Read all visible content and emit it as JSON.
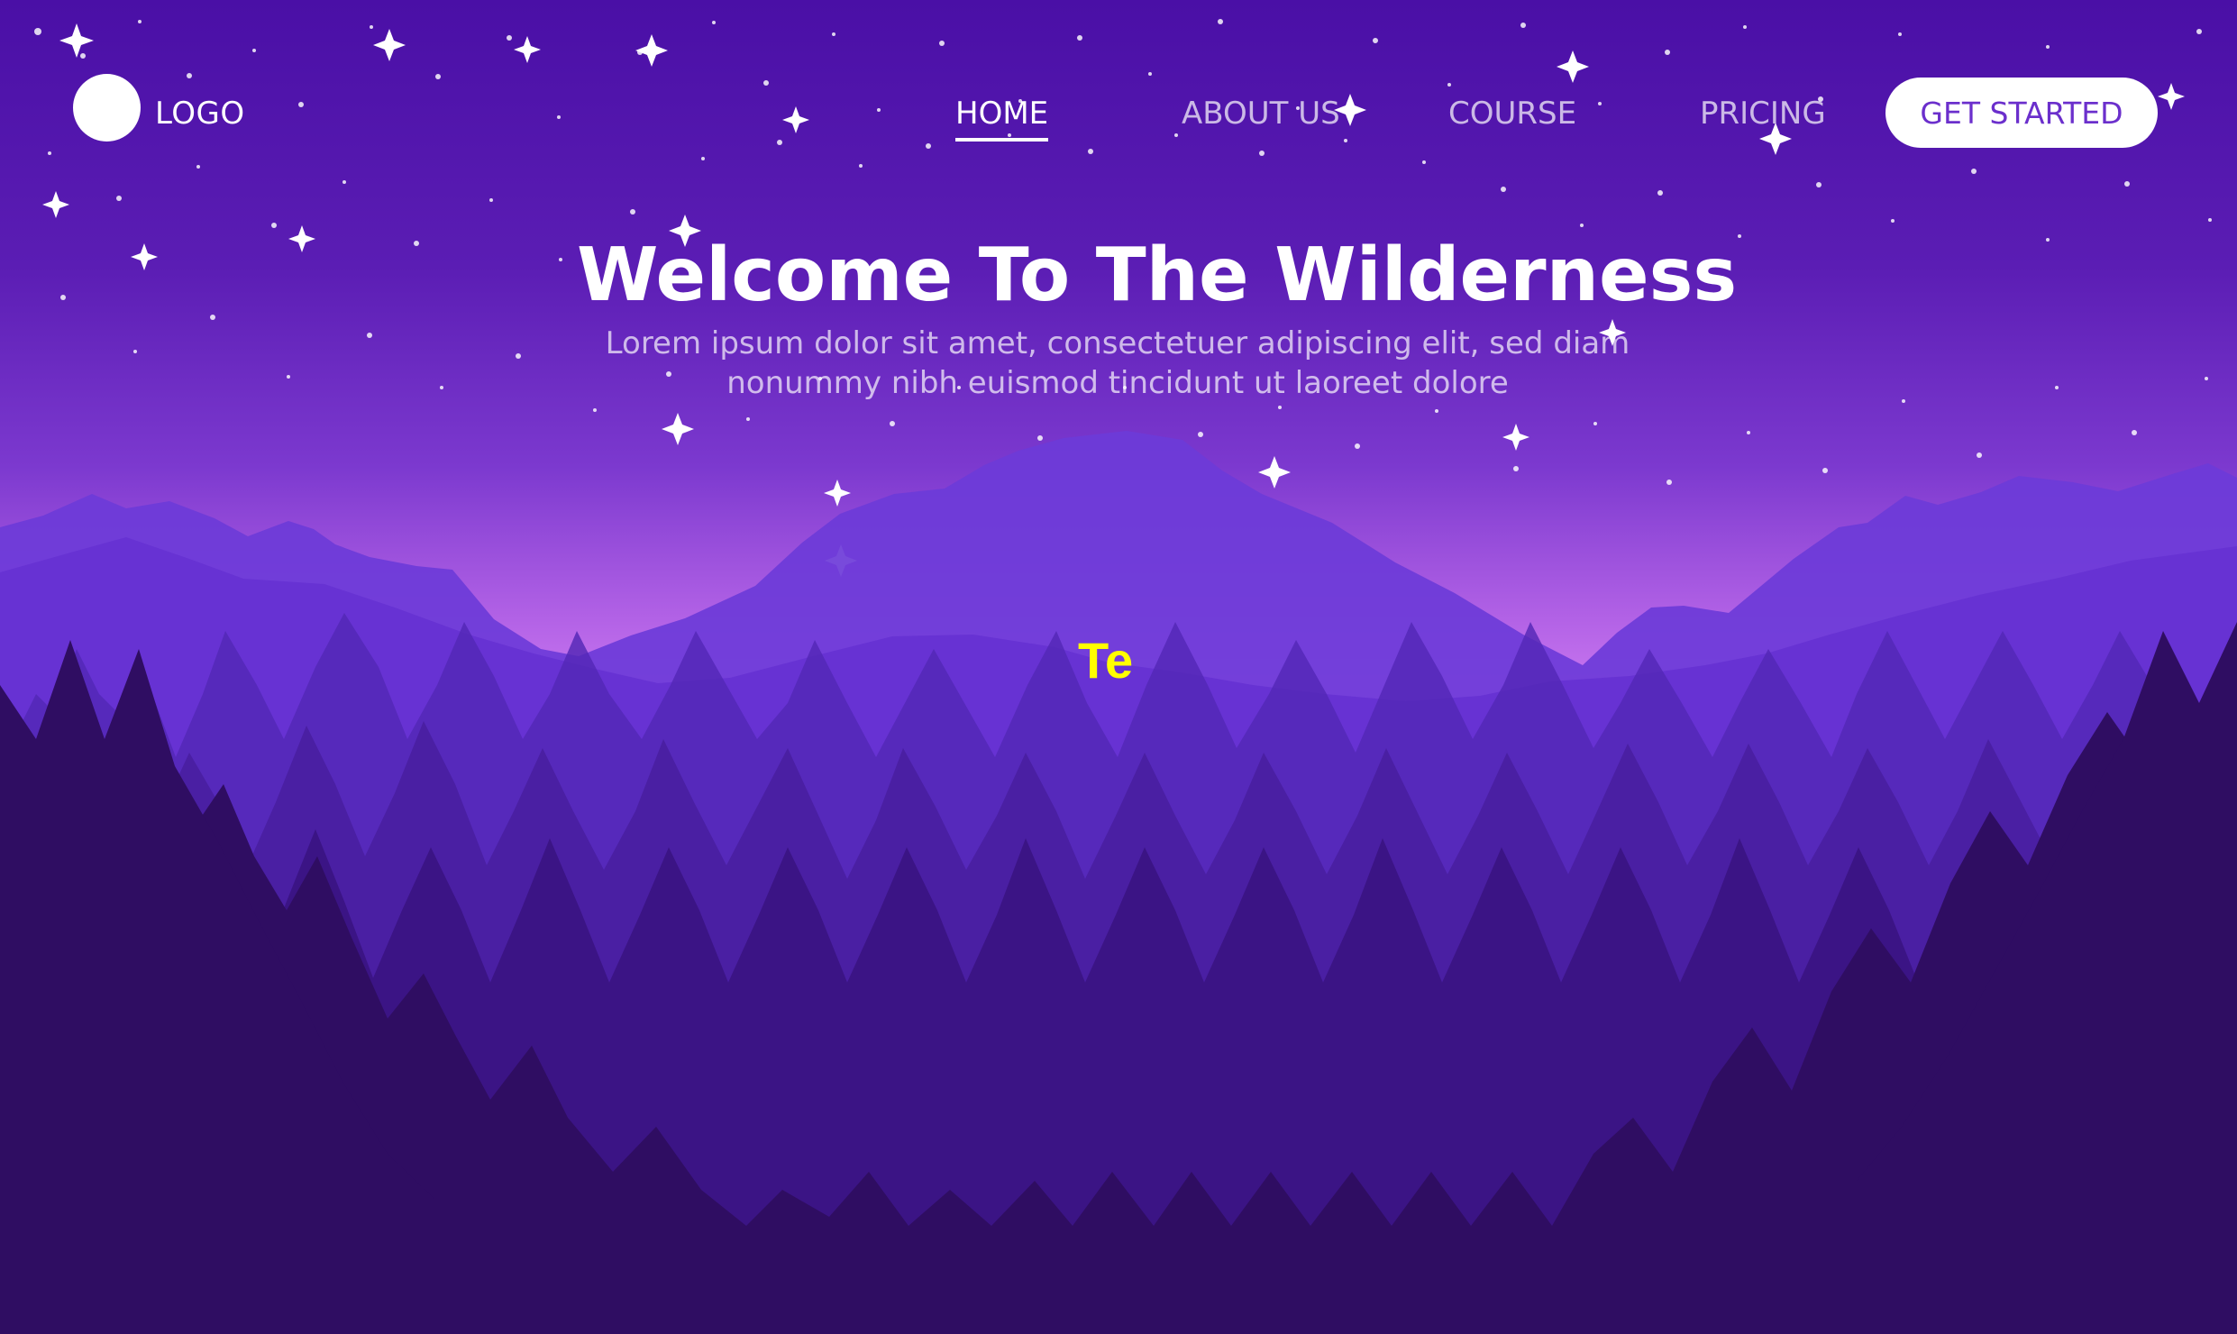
{
  "brand": {
    "logo_text": "LOGO"
  },
  "nav": {
    "items": [
      {
        "label": "HOME",
        "active": true
      },
      {
        "label": "ABOUT US",
        "active": false
      },
      {
        "label": "COURSE",
        "active": false
      },
      {
        "label": "PRICING",
        "active": false
      }
    ],
    "cta_label": "GET STARTED"
  },
  "hero": {
    "title": "Welcome To The Wilderness",
    "subtitle": "Lorem ipsum dolor sit amet, consectetuer adipiscing elit, sed diam nonummy nibh euismod tincidunt ut laoreet dolore"
  },
  "overlay": {
    "text": "Te"
  },
  "colors": {
    "sky_top": "#4a0fa6",
    "sky_glow": "#c978f0",
    "forest_dark": "#35105f",
    "accent": "#6b2fcc",
    "overlay_text": "#ffff00"
  },
  "icons": {
    "logo": "circle-logo-icon",
    "stars": "sparkle-star-icon"
  }
}
